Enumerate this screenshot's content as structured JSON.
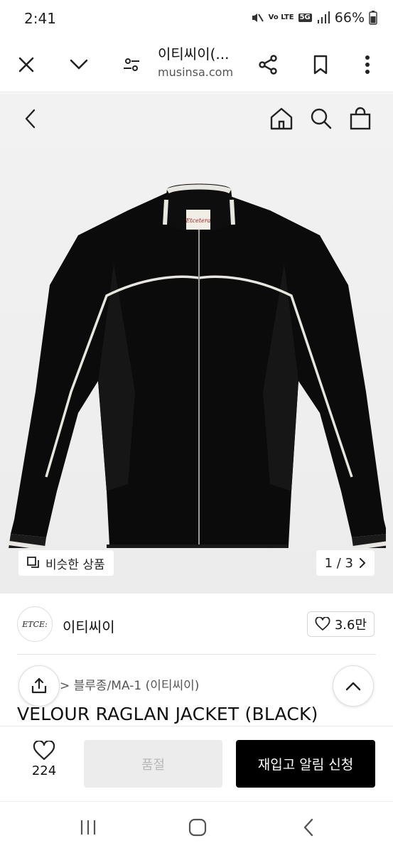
{
  "status": {
    "time": "2:41",
    "network": "5G",
    "lte": "Vo LTE",
    "battery": "66%"
  },
  "browser": {
    "title": "이티씨이(...",
    "url": "musinsa.com"
  },
  "gallery": {
    "similar_label": "비슷한 상품",
    "counter": "1 / 3"
  },
  "brand": {
    "logo_text": "ETCE:",
    "name": "이티씨이",
    "likes": "3.6만"
  },
  "product": {
    "category": "> 블루종/MA-1 (이티씨이)",
    "title": "VELOUR RAGLAN JACKET (BLACK)",
    "jacket_label": "Etcetera"
  },
  "actions": {
    "like_count": "224",
    "soldout_label": "품절",
    "restock_label": "재입고 알림 신청"
  },
  "colors": {
    "primary_button": "#000000",
    "disabled_button": "#ececec",
    "background": "#ffffff"
  }
}
